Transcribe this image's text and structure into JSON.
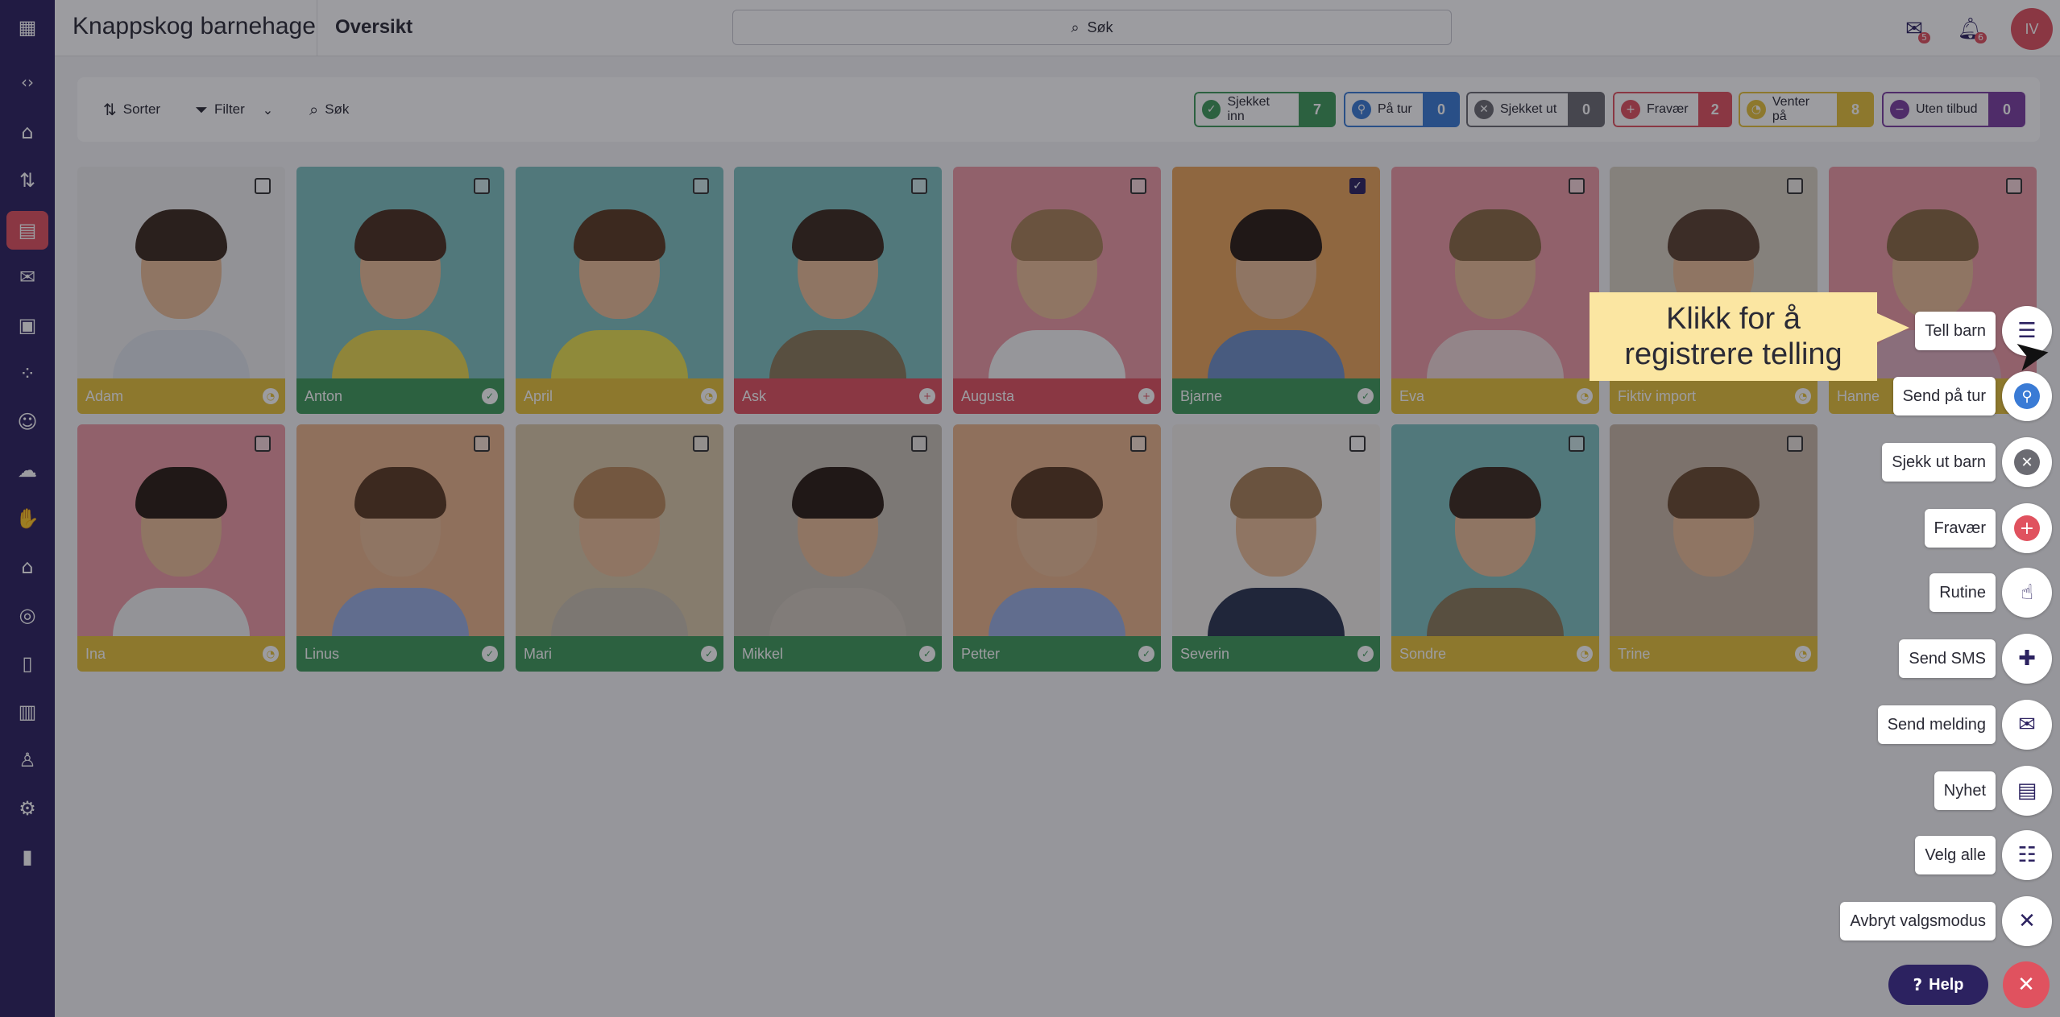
{
  "header": {
    "org_title": "Knappskog barnehage",
    "page_title": "Oversikt",
    "search_label": "Søk",
    "messages_badge": "5",
    "notifications_badge": "6",
    "avatar_initials": "IV"
  },
  "toolbar": {
    "sort_label": "Sorter",
    "filter_label": "Filter",
    "search_label": "Søk"
  },
  "status_chips": [
    {
      "label": "Sjekket inn",
      "count": "7",
      "color": "#3f9a5a",
      "icon": "check-circle-icon"
    },
    {
      "label": "På tur",
      "count": "0",
      "color": "#3a7bd5",
      "icon": "walk-icon"
    },
    {
      "label": "Sjekket ut",
      "count": "0",
      "color": "#6b6b72",
      "icon": "x-circle-icon"
    },
    {
      "label": "Fravær",
      "count": "2",
      "color": "#e0525f",
      "icon": "plus-circle-icon"
    },
    {
      "label": "Venter på",
      "count": "8",
      "color": "#e6c23a",
      "icon": "clock-icon"
    },
    {
      "label": "Uten tilbud",
      "count": "0",
      "color": "#7b3fa0",
      "icon": "minus-circle-icon"
    }
  ],
  "children": [
    {
      "name": "Adam",
      "status": "waiting",
      "checked": false
    },
    {
      "name": "Anton",
      "status": "checked-in",
      "checked": false
    },
    {
      "name": "April",
      "status": "waiting",
      "checked": false
    },
    {
      "name": "Ask",
      "status": "absent",
      "checked": false
    },
    {
      "name": "Augusta",
      "status": "absent",
      "checked": false
    },
    {
      "name": "Bjarne",
      "status": "checked-in",
      "checked": true
    },
    {
      "name": "Eva",
      "status": "waiting",
      "checked": false
    },
    {
      "name": "Fiktiv import",
      "status": "waiting",
      "checked": false
    },
    {
      "name": "Hanne",
      "status": "waiting",
      "checked": false
    },
    {
      "name": "Ina",
      "status": "waiting",
      "checked": false
    },
    {
      "name": "Linus",
      "status": "checked-in",
      "checked": false
    },
    {
      "name": "Mari",
      "status": "checked-in",
      "checked": false
    },
    {
      "name": "Mikkel",
      "status": "checked-in",
      "checked": false
    },
    {
      "name": "Petter",
      "status": "checked-in",
      "checked": false
    },
    {
      "name": "Severin",
      "status": "checked-in",
      "checked": false
    },
    {
      "name": "Sondre",
      "status": "waiting",
      "checked": false
    },
    {
      "name": "Trine",
      "status": "waiting",
      "checked": false
    }
  ],
  "status_colors": {
    "checked-in": "#3f9a5a",
    "waiting": "#e6c23a",
    "absent": "#e0525f"
  },
  "actions": [
    {
      "label": "Tell barn",
      "icon": "list-icon"
    },
    {
      "label": "Send på tur",
      "icon": "walk-icon"
    },
    {
      "label": "Sjekk ut barn",
      "icon": "x-circle-icon"
    },
    {
      "label": "Fravær",
      "icon": "plus-circle-icon"
    },
    {
      "label": "Rutine",
      "icon": "hand-icon"
    },
    {
      "label": "Send SMS",
      "icon": "sms-icon"
    },
    {
      "label": "Send melding",
      "icon": "envelope-icon"
    },
    {
      "label": "Nyhet",
      "icon": "newspaper-icon"
    },
    {
      "label": "Velg alle",
      "icon": "checklist-icon"
    },
    {
      "label": "Avbryt valgsmodus",
      "icon": "close-icon"
    }
  ],
  "tooltip": {
    "text": "Klikk for å registrere telling"
  },
  "help_label": "Help"
}
